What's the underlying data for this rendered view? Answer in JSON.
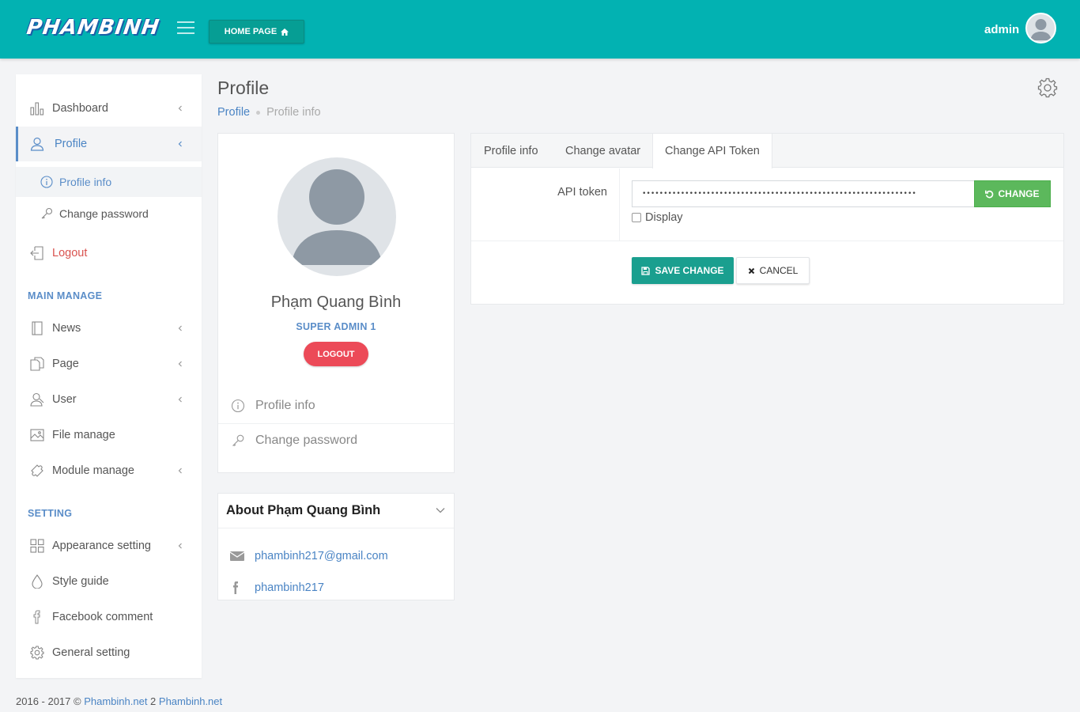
{
  "header": {
    "logo_text": "PHAMBINH",
    "homepage_label": "HOME PAGE",
    "admin_name": "admin"
  },
  "sidebar": {
    "items": [
      {
        "label": "Dashboard",
        "icon": "bar-chart-icon"
      },
      {
        "label": "Profile",
        "icon": "user-icon"
      },
      {
        "label": "Profile info",
        "icon": "info-icon"
      },
      {
        "label": "Change password",
        "icon": "key-icon"
      },
      {
        "label": "Logout",
        "icon": "logout-icon"
      }
    ],
    "main_manage_heading": "MAIN MANAGE",
    "main_manage": [
      {
        "label": "News",
        "icon": "notebook-icon"
      },
      {
        "label": "Page",
        "icon": "pages-icon"
      },
      {
        "label": "User",
        "icon": "users-icon"
      },
      {
        "label": "File manage",
        "icon": "image-icon"
      },
      {
        "label": "Module manage",
        "icon": "puzzle-icon"
      }
    ],
    "setting_heading": "SETTING",
    "setting": [
      {
        "label": "Appearance setting",
        "icon": "grid-icon"
      },
      {
        "label": "Style guide",
        "icon": "drop-icon"
      },
      {
        "label": "Facebook comment",
        "icon": "facebook-icon"
      },
      {
        "label": "General setting",
        "icon": "gear-icon"
      }
    ]
  },
  "page": {
    "title": "Profile",
    "breadcrumb": [
      "Profile",
      "Profile info"
    ]
  },
  "profile_card": {
    "name": "Phạm Quang Bình",
    "role": "SUPER ADMIN 1",
    "logout_label": "LOGOUT",
    "links": [
      "Profile info",
      "Change password"
    ]
  },
  "about": {
    "title": "About Phạm Quang Bình",
    "email": "phambinh217@gmail.com",
    "facebook": "phambinh217"
  },
  "tabs": {
    "items": [
      "Profile info",
      "Change avatar",
      "Change API Token"
    ],
    "active": "Change API Token"
  },
  "api_form": {
    "label": "API token",
    "token_masked": "••••••••••••••••••••••••••••••••••••••••••••••••••••••••••••••••",
    "change_label": "CHANGE",
    "display_label": "Display",
    "display_checked": false,
    "save_label": "SAVE CHANGE",
    "cancel_label": "CANCEL"
  },
  "footer": {
    "copyright": "2016 - 2017 © ",
    "link1": "Phambinh.net",
    "mid": " 2 ",
    "link2": "Phambinh.net"
  },
  "colors": {
    "header_bg": "#02b2b2",
    "accent_blue": "#4a84c4",
    "logout_red": "#ec4a58",
    "change_green": "#5cb85c",
    "save_teal": "#1a9f8f"
  }
}
